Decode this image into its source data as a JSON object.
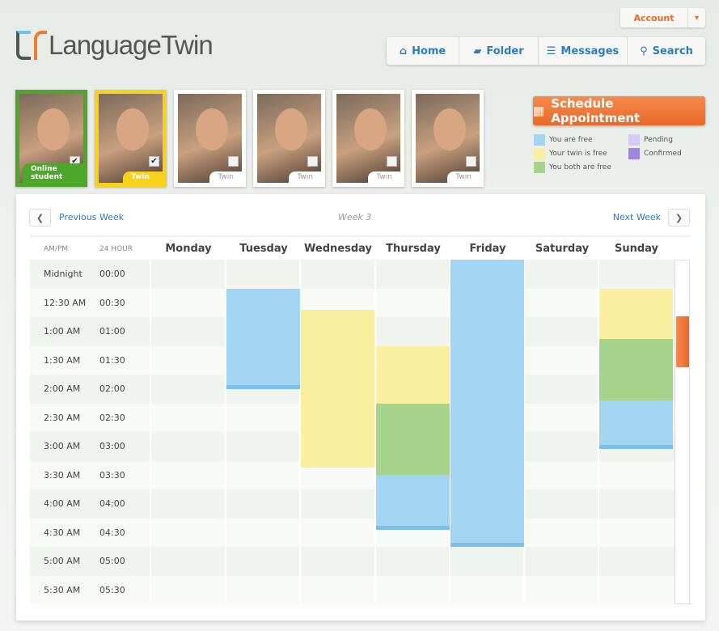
{
  "brand": "LanguageTwin",
  "account": "Account",
  "nav": [
    {
      "label": "Home",
      "icon": "home-icon"
    },
    {
      "label": "Folder",
      "icon": "folder-icon"
    },
    {
      "label": "Messages",
      "icon": "list-icon"
    },
    {
      "label": "Search",
      "icon": "search-icon"
    }
  ],
  "cards": [
    {
      "label": "Online student",
      "checked": true,
      "style": "green"
    },
    {
      "label": "Twin",
      "checked": true,
      "style": "yellow"
    },
    {
      "label": "Twin",
      "checked": false,
      "style": ""
    },
    {
      "label": "Twin",
      "checked": false,
      "style": ""
    },
    {
      "label": "Twin",
      "checked": false,
      "style": ""
    },
    {
      "label": "Twin",
      "checked": false,
      "style": ""
    }
  ],
  "schedule_label": "Schedule Appointment",
  "legend": [
    {
      "label": "You are free",
      "color": "#a2d5f2"
    },
    {
      "label": "Your twin is free",
      "color": "#f9ef9f"
    },
    {
      "label": "You both are free",
      "color": "#a7d48c"
    },
    {
      "label": "Pending",
      "color": "#d6cbf5"
    },
    {
      "label": "Confirmed",
      "color": "#9b85e0"
    }
  ],
  "calendar": {
    "prev": "Previous Week",
    "next": "Next Week",
    "week": "Week 3",
    "col_ampm": "AM/PM",
    "col_24": "24 HOUR",
    "days": [
      "Monday",
      "Tuesday",
      "Wednesday",
      "Thursday",
      "Friday",
      "Saturday",
      "Sunday"
    ],
    "rows": [
      [
        "Midnight",
        "00:00"
      ],
      [
        "12:30 AM",
        "00:30"
      ],
      [
        "1:00 AM",
        "01:00"
      ],
      [
        "1:30 AM",
        "01:30"
      ],
      [
        "2:00 AM",
        "02:00"
      ],
      [
        "2:30 AM",
        "02:30"
      ],
      [
        "3:00 AM",
        "03:00"
      ],
      [
        "3:30 AM",
        "03:30"
      ],
      [
        "4:00 AM",
        "04:00"
      ],
      [
        "4:30 AM",
        "04:30"
      ],
      [
        "5:00 AM",
        "05:00"
      ],
      [
        "5:30 AM",
        "05:30"
      ]
    ],
    "blocks": [
      {
        "day": 1,
        "start": 0.5,
        "end": 2.25,
        "type": "blue"
      },
      {
        "day": 2,
        "start": 0.875,
        "end": 3.625,
        "type": "yellow"
      },
      {
        "day": 3,
        "start": 1.5,
        "end": 2.5,
        "type": "yellow"
      },
      {
        "day": 3,
        "start": 2.5,
        "end": 3.75,
        "type": "green"
      },
      {
        "day": 3,
        "start": 3.75,
        "end": 4.7,
        "type": "blue"
      },
      {
        "day": 4,
        "start": 0,
        "end": 5,
        "type": "blue"
      },
      {
        "day": 6,
        "start": 0.5,
        "end": 1.375,
        "type": "yellow"
      },
      {
        "day": 6,
        "start": 1.375,
        "end": 2.45,
        "type": "green"
      },
      {
        "day": 6,
        "start": 2.45,
        "end": 3.3,
        "type": "blue"
      }
    ]
  }
}
